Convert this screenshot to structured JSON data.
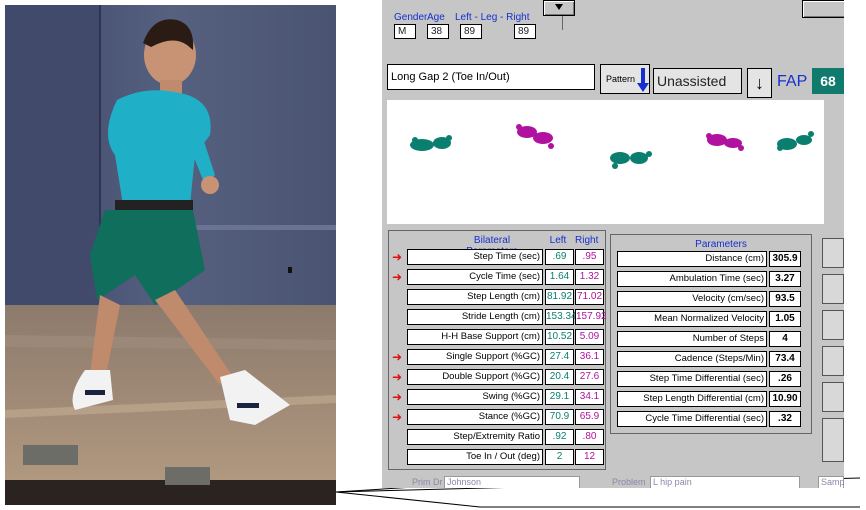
{
  "header": {
    "gender_label": "Gender",
    "age_label": "Age",
    "leg_label": "Left - Leg - Right",
    "gender": "M",
    "age": "38",
    "left_leg": "89",
    "right_leg": "89",
    "dropdown_icon": "triangle-down-icon"
  },
  "pattern": {
    "title": "Long Gap 2 (Toe In/Out)",
    "button_label": "Pattern",
    "button_icon": "arrow-down-icon",
    "assistance": "Unassisted",
    "fap_label": "FAP",
    "fap_value": "68"
  },
  "bilateral": {
    "header": "Bilateral Parameters",
    "left_header": "Left",
    "right_header": "Right",
    "rows": [
      {
        "label": "Step Time (sec)",
        "left": ".69",
        "right": ".95",
        "flag": true
      },
      {
        "label": "Cycle Time (sec)",
        "left": "1.64",
        "right": "1.32",
        "flag": true
      },
      {
        "label": "Step Length (cm)",
        "left": "81.92",
        "right": "71.02",
        "flag": false
      },
      {
        "label": "Stride Length (cm)",
        "left": "153.34",
        "right": "157.92",
        "flag": false
      },
      {
        "label": "H-H Base Support (cm)",
        "left": "10.52",
        "right": "5.09",
        "flag": false
      },
      {
        "label": "Single Support (%GC)",
        "left": "27.4",
        "right": "36.1",
        "flag": true
      },
      {
        "label": "Double Support (%GC)",
        "left": "20.4",
        "right": "27.6",
        "flag": true
      },
      {
        "label": "Swing (%GC)",
        "left": "29.1",
        "right": "34.1",
        "flag": true
      },
      {
        "label": "Stance (%GC)",
        "left": "70.9",
        "right": "65.9",
        "flag": true
      },
      {
        "label": "Step/Extremity Ratio",
        "left": ".92",
        "right": ".80",
        "flag": false
      },
      {
        "label": "Toe In / Out (deg)",
        "left": "2",
        "right": "12",
        "flag": false
      }
    ]
  },
  "parameters": {
    "header": "Parameters",
    "rows": [
      {
        "label": "Distance (cm)",
        "value": "305.9"
      },
      {
        "label": "Ambulation Time (sec)",
        "value": "3.27"
      },
      {
        "label": "Velocity (cm/sec)",
        "value": "93.5"
      },
      {
        "label": "Mean Normalized Velocity",
        "value": "1.05"
      },
      {
        "label": "Number of Steps",
        "value": "4"
      },
      {
        "label": "Cadence (Steps/Min)",
        "value": "73.4"
      },
      {
        "label": "Step Time Differential (sec)",
        "value": ".26"
      },
      {
        "label": "Step Length Differential (cm)",
        "value": "10.90"
      },
      {
        "label": "Cycle Time Differential (sec)",
        "value": ".32"
      }
    ]
  },
  "footer": {
    "prim_dr_label": "Prim Dr",
    "prim_dr": "Johnson",
    "problem_label": "Problem",
    "problem": "L hip pain",
    "sample_text": "Samp"
  },
  "colors": {
    "left_foot": "#0a7f6f",
    "right_foot": "#b0119f",
    "fap_bg": "#107a6d",
    "flag_arrow": "#e01010",
    "label_blue": "#1530d0"
  }
}
